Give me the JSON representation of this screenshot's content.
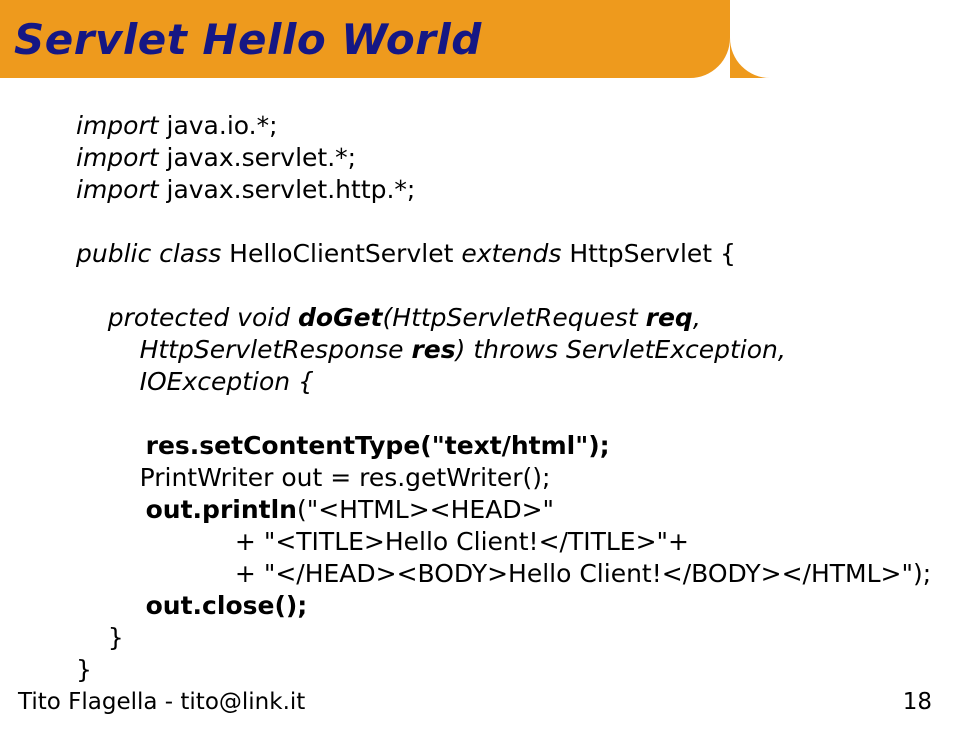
{
  "title": "Servlet Hello World",
  "code": {
    "l1a": "import",
    "l1b": " java.io.*;",
    "l2a": "import",
    "l2b": " javax.servlet.*;",
    "l3a": "import",
    "l3b": " javax.servlet.http.*;",
    "l4a": "public class",
    "l4b": " HelloClientServlet ",
    "l4c": "extends",
    "l4d": " HttpServlet {",
    "l5a": "    protected void ",
    "l5b": "doGet",
    "l5c": "(HttpServletRequest ",
    "l5d": "req",
    "l5e": ",",
    "l6a": "        HttpServletResponse ",
    "l6b": "res",
    "l6c": ") ",
    "l6d": "throws",
    "l6e": " ServletException,",
    "l7": "        IOException {",
    "l8": "        res.setContentType(\"text/html\");",
    "l9a": "        ",
    "l9b": "PrintWriter out = res.getWriter();",
    "l10": "        out.println",
    "l10b": "(\"<HTML><HEAD>\"",
    "l11": "                    + \"<TITLE>Hello Client!</TITLE>\"+",
    "l12": "                    + \"</HEAD><BODY>Hello Client!</BODY></HTML>\");",
    "l13": "        out.close();",
    "l14": "    }",
    "l15": "}"
  },
  "footer": {
    "left": "Tito Flagella - tito@link.it",
    "right": "18"
  }
}
